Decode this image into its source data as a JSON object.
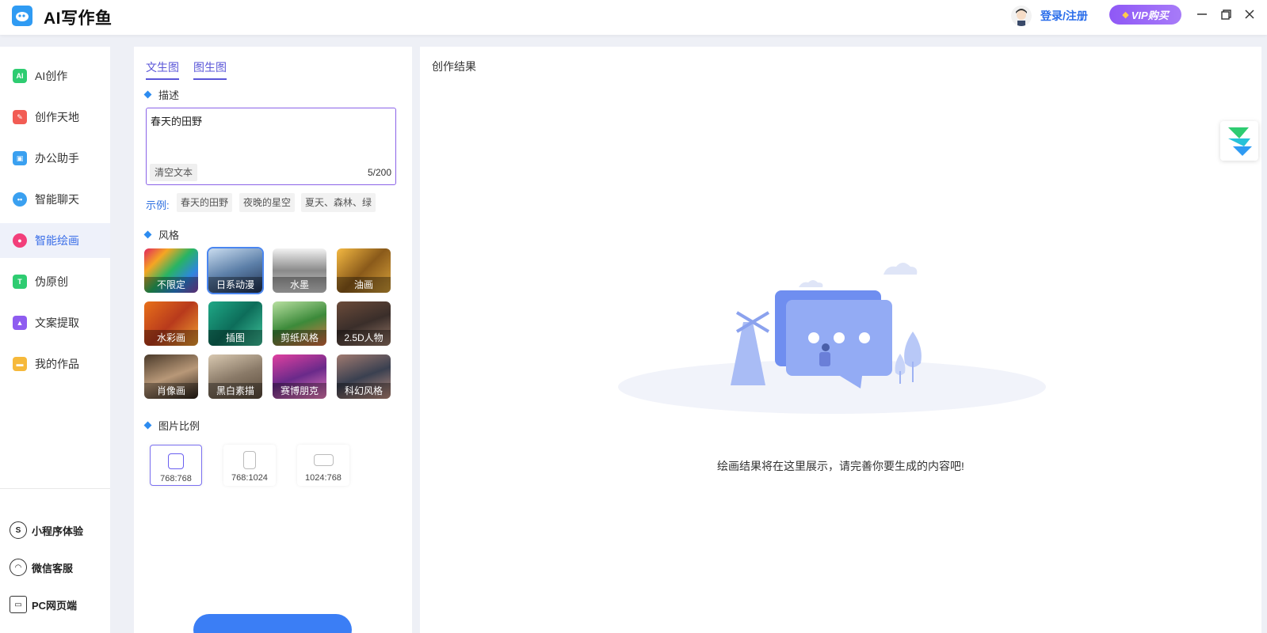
{
  "app": {
    "title": "AI写作鱼",
    "login": "登录/注册",
    "vip": "VIP购买"
  },
  "sidebar": {
    "items": [
      {
        "label": "AI创作",
        "icon": "ai-icon",
        "color": "#2ecc71"
      },
      {
        "label": "创作天地",
        "icon": "pen-icon",
        "color": "#f25c54"
      },
      {
        "label": "办公助手",
        "icon": "briefcase-icon",
        "color": "#3aa0f0"
      },
      {
        "label": "智能聊天",
        "icon": "chat-icon",
        "color": "#3aa0f0"
      },
      {
        "label": "智能绘画",
        "icon": "palette-icon",
        "color": "#f23f7a"
      },
      {
        "label": "伪原创",
        "icon": "text-icon",
        "color": "#2ecc71"
      },
      {
        "label": "文案提取",
        "icon": "extract-icon",
        "color": "#8e5cf0"
      },
      {
        "label": "我的作品",
        "icon": "folder-icon",
        "color": "#f6b93b"
      }
    ],
    "active_index": 4,
    "bottom": {
      "miniprogram": "小程序体验",
      "wechat": "微信客服",
      "pc": "PC网页端"
    }
  },
  "panel": {
    "tabs": [
      "文生图",
      "图生图"
    ],
    "desc_title": "描述",
    "desc_value": "春天的田野",
    "clear": "清空文本",
    "counter": "5/200",
    "examples_label": "示例:",
    "examples": [
      "春天的田野",
      "夜晚的星空",
      "夏天、森林、绿"
    ],
    "style_title": "风格",
    "styles": [
      "不限定",
      "日系动漫",
      "水墨",
      "油画",
      "水彩画",
      "插图",
      "剪纸风格",
      "2.5D人物",
      "肖像画",
      "黑白素描",
      "赛博朋克",
      "科幻风格"
    ],
    "style_selected": 1,
    "ratio_title": "图片比例",
    "ratios": [
      "768:768",
      "768:1024",
      "1024:768"
    ],
    "ratio_selected": 0
  },
  "result": {
    "title": "创作结果",
    "empty": "绘画结果将在这里展示，请完善你要生成的内容吧!"
  },
  "colors": {
    "accent": "#5a56d8",
    "primary": "#3b7ef5",
    "vip": "#8f58f6"
  }
}
